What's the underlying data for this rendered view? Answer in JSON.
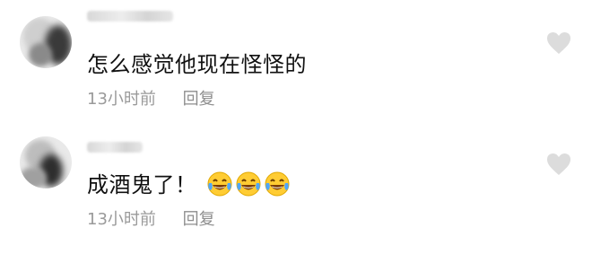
{
  "comments": [
    {
      "text": "怎么感觉他现在怪怪的",
      "time": "13小时前",
      "reply_label": "回复",
      "like_icon": "heart-outline-icon",
      "avatar": "blurred-avatar"
    },
    {
      "text": "成酒鬼了！",
      "time": "13小时前",
      "reply_label": "回复",
      "like_icon": "heart-outline-icon",
      "avatar": "blurred-avatar",
      "emojis": [
        "tears-of-joy-emoji",
        "tears-of-joy-emoji",
        "tears-of-joy-emoji"
      ]
    }
  ],
  "colors": {
    "meta": "#9a9a9a",
    "text": "#111111",
    "heart": "#d9d9d9"
  }
}
